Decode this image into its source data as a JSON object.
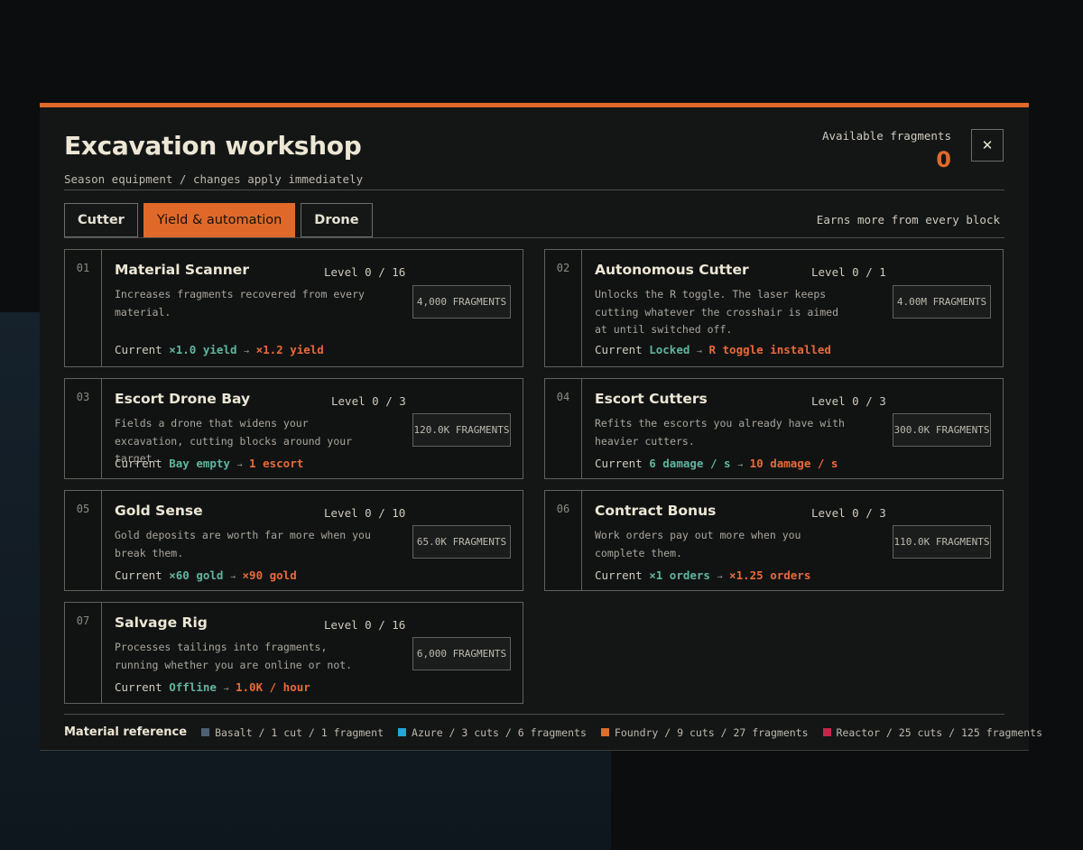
{
  "header": {
    "title": "Excavation workshop",
    "subtitle": "Season equipment / changes apply immediately",
    "fragments_label": "Available fragments",
    "fragments_value": "0",
    "close_label": "✕"
  },
  "tabs": [
    {
      "label": "Cutter",
      "active": false
    },
    {
      "label": "Yield & automation",
      "active": true
    },
    {
      "label": "Drone",
      "active": false
    }
  ],
  "tab_hint": "Earns more from every block",
  "upgrades": [
    {
      "num": "01",
      "name": "Material Scanner",
      "level": "Level 0 / 16",
      "desc": "Increases fragments recovered from every material.",
      "cost": "4,000 FRAGMENTS",
      "current_label": "Current",
      "from": "×1.0 yield",
      "arrow": "→",
      "to": "×1.2 yield"
    },
    {
      "num": "02",
      "name": "Autonomous Cutter",
      "level": "Level 0 / 1",
      "desc": "Unlocks the R toggle. The laser keeps cutting whatever the crosshair is aimed at until switched off.",
      "cost": "4.00M FRAGMENTS",
      "current_label": "Current",
      "from": "Locked",
      "arrow": "→",
      "to": "R toggle installed"
    },
    {
      "num": "03",
      "name": "Escort Drone Bay",
      "level": "Level 0 / 3",
      "desc": "Fields a drone that widens your excavation, cutting blocks around your target.",
      "cost": "120.0K FRAGMENTS",
      "current_label": "Current",
      "from": "Bay empty",
      "arrow": "→",
      "to": "1 escort"
    },
    {
      "num": "04",
      "name": "Escort Cutters",
      "level": "Level 0 / 3",
      "desc": "Refits the escorts you already have with heavier cutters.",
      "cost": "300.0K FRAGMENTS",
      "current_label": "Current",
      "from": "6 damage / s",
      "arrow": "→",
      "to": "10 damage / s"
    },
    {
      "num": "05",
      "name": "Gold Sense",
      "level": "Level 0 / 10",
      "desc": "Gold deposits are worth far more when you break them.",
      "cost": "65.0K FRAGMENTS",
      "current_label": "Current",
      "from": "×60 gold",
      "arrow": "→",
      "to": "×90 gold"
    },
    {
      "num": "06",
      "name": "Contract Bonus",
      "level": "Level 0 / 3",
      "desc": "Work orders pay out more when you complete them.",
      "cost": "110.0K FRAGMENTS",
      "current_label": "Current",
      "from": "×1 orders",
      "arrow": "→",
      "to": "×1.25 orders"
    },
    {
      "num": "07",
      "name": "Salvage Rig",
      "level": "Level 0 / 16",
      "desc": "Processes tailings into fragments, running whether you are online or not.",
      "cost": "6,000 FRAGMENTS",
      "current_label": "Current",
      "from": "Offline",
      "arrow": "→",
      "to": "1.0K / hour"
    }
  ],
  "legend": {
    "title": "Material reference",
    "items": [
      {
        "color": "#4b6173",
        "label": "Basalt / 1 cut / 1 fragment"
      },
      {
        "color": "#1fa8d8",
        "label": "Azure / 3 cuts / 6 fragments"
      },
      {
        "color": "#d9702e",
        "label": "Foundry / 9 cuts / 27 fragments"
      },
      {
        "color": "#c8244a",
        "label": "Reactor / 25 cuts / 125 fragments"
      }
    ]
  }
}
